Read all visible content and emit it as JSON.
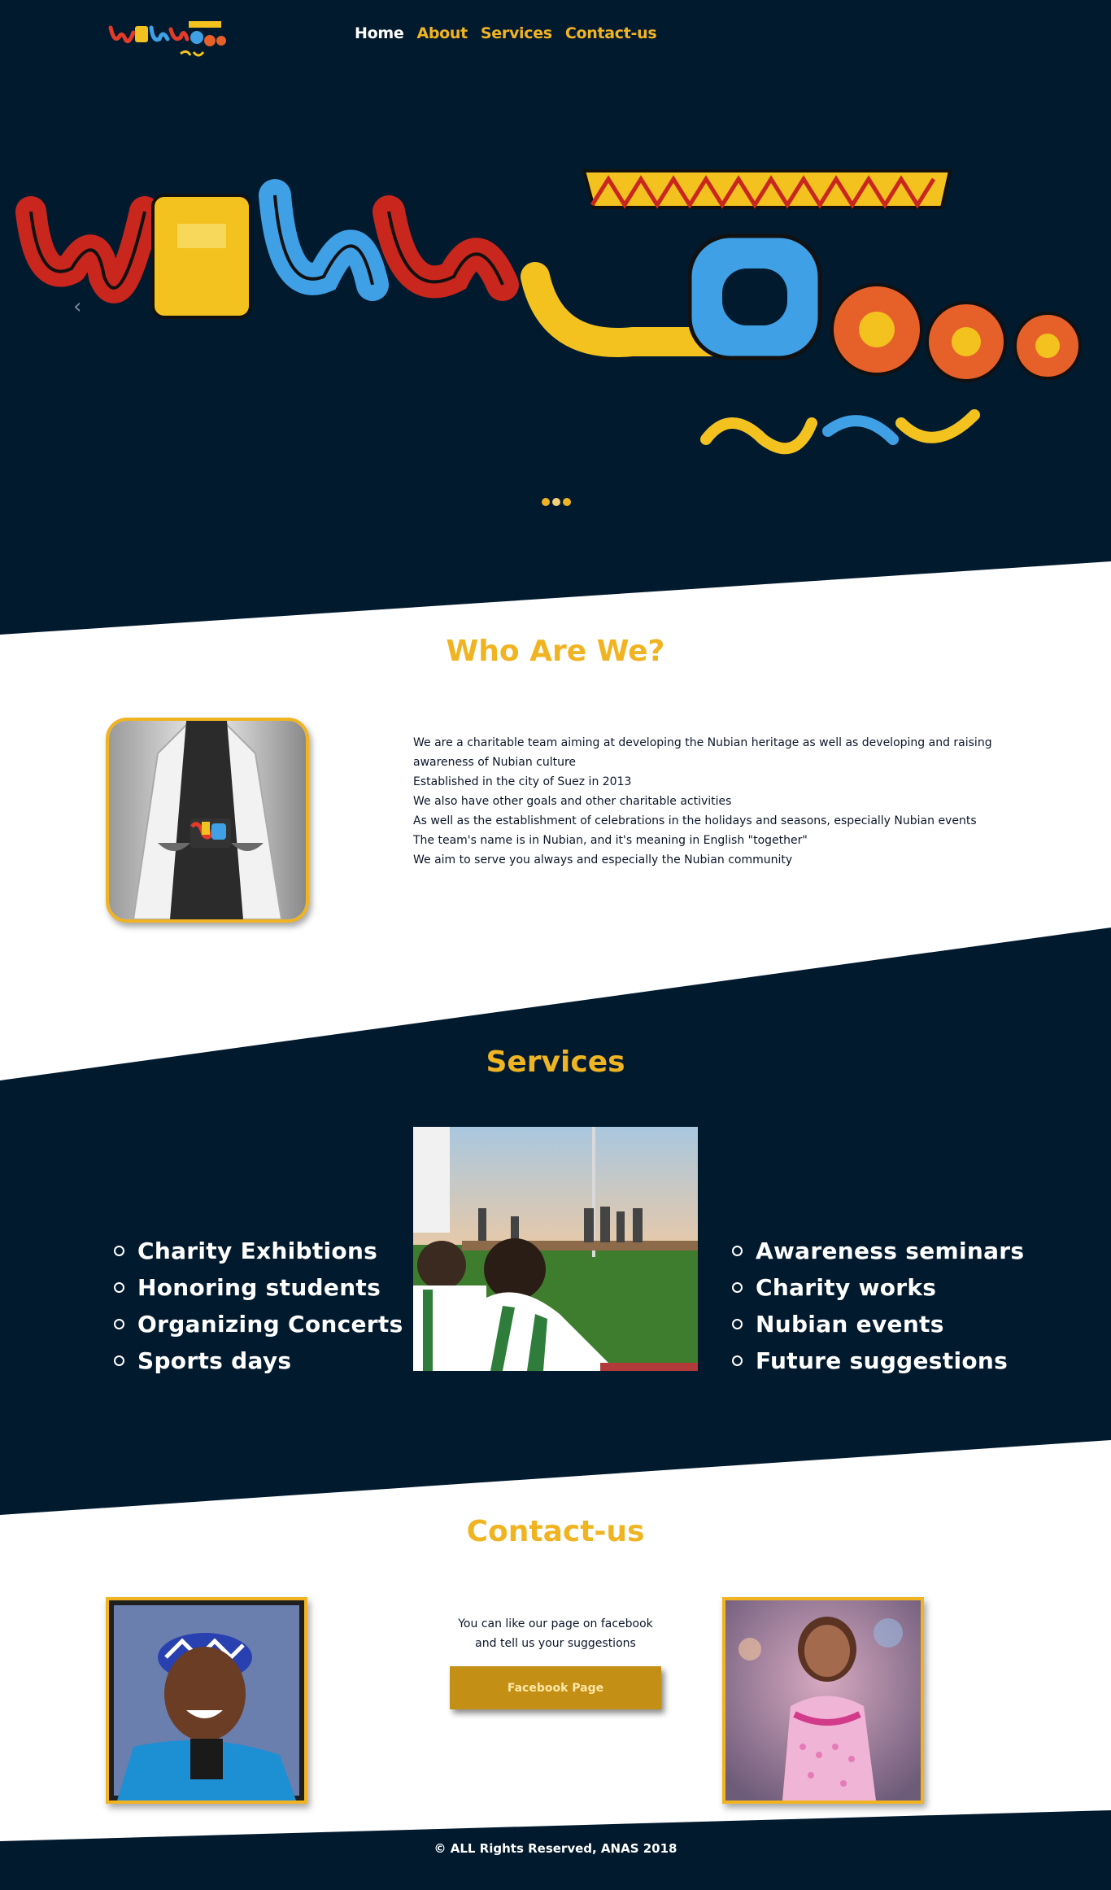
{
  "nav": {
    "logo_alt": "WeRwuDoo",
    "items": [
      {
        "label": "Home",
        "active": true
      },
      {
        "label": "About",
        "active": false
      },
      {
        "label": "Services",
        "active": false
      },
      {
        "label": "Contact-us",
        "active": false
      }
    ]
  },
  "hero": {
    "prev_arrow": "‹",
    "slide_count": 3,
    "active_slide": 1
  },
  "about": {
    "title": "Who Are We?",
    "lines": [
      "We are a charitable team aiming at developing the Nubian heritage as well as developing and raising awareness of Nubian culture",
      "Established in the city of Suez in 2013",
      "We also have other goals and other charitable activities",
      "As well as the establishment of celebrations in the holidays and seasons, especially Nubian events",
      "The team's name is in Nubian, and it's meaning in English \"together\"",
      "We aim to serve you always and especially the Nubian community"
    ]
  },
  "services": {
    "title": "Services",
    "left": [
      "Charity Exhibtions",
      "Honoring students",
      "Organizing Concerts",
      "Sports days"
    ],
    "right": [
      "Awareness seminars",
      "Charity works",
      "Nubian events",
      "Future suggestions"
    ]
  },
  "contact": {
    "title": "Contact-us",
    "line1": "You can like our page on facebook",
    "line2": "and tell us your suggestions",
    "button": "Facebook Page"
  },
  "footer": {
    "text": "© ALL Rights Reserved, ANAS 2018"
  },
  "colors": {
    "navy": "#021a2e",
    "accent": "#f0b423",
    "button": "#c38f14"
  }
}
